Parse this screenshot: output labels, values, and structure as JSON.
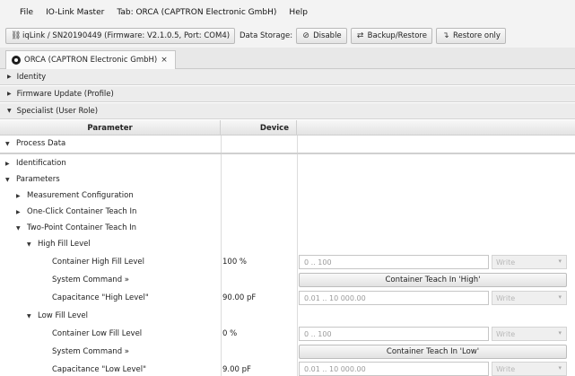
{
  "menu": [
    "File",
    "IO-Link Master",
    "Tab: ORCA (CAPTRON Electronic GmbH)",
    "Help"
  ],
  "toolbar": {
    "device_label": "iqLink / SN20190449 (Firmware: V2.1.0.5, Port: COM4)",
    "data_storage_label": "Data Storage:",
    "disable_label": "Disable",
    "backup_label": "Backup/Restore",
    "restore_label": "Restore only"
  },
  "tab": {
    "label": "ORCA (CAPTRON Electronic GmbH)",
    "close": "×"
  },
  "sections": {
    "identity": "Identity",
    "firmware": "Firmware Update (Profile)",
    "specialist": "Specialist (User Role)"
  },
  "table": {
    "col_parameter": "Parameter",
    "col_device": "Device"
  },
  "tree": {
    "process_data": "Process Data",
    "identification": "Identification",
    "parameters": "Parameters",
    "measurement_config": "Measurement Configuration",
    "one_click": "One-Click Container Teach In",
    "two_point": "Two-Point Container Teach In",
    "high_fill": "High Fill Level",
    "low_fill": "Low Fill Level"
  },
  "rows": {
    "container_high": {
      "label": "Container High Fill Level",
      "value": "100 %",
      "placeholder": "0 .. 100",
      "select": "Write"
    },
    "system_cmd_high": {
      "label": "System Command »",
      "button": "Container Teach In 'High'"
    },
    "cap_high": {
      "label": "Capacitance \"High Level\"",
      "value": "90.00 pF",
      "placeholder": "0.01 .. 10 000.00",
      "select": "Write"
    },
    "container_low": {
      "label": "Container Low Fill Level",
      "value": "0 %",
      "placeholder": "0 .. 100",
      "select": "Write"
    },
    "system_cmd_low": {
      "label": "System Command »",
      "button": "Container Teach In 'Low'"
    },
    "cap_low": {
      "label": "Capacitance \"Low Level\"",
      "value": "9.00 pF",
      "placeholder": "0.01 .. 10 000.00",
      "select": "Write"
    }
  },
  "icons": {
    "expanded": "▼",
    "collapsed": "▶",
    "dropdown": "▾"
  }
}
